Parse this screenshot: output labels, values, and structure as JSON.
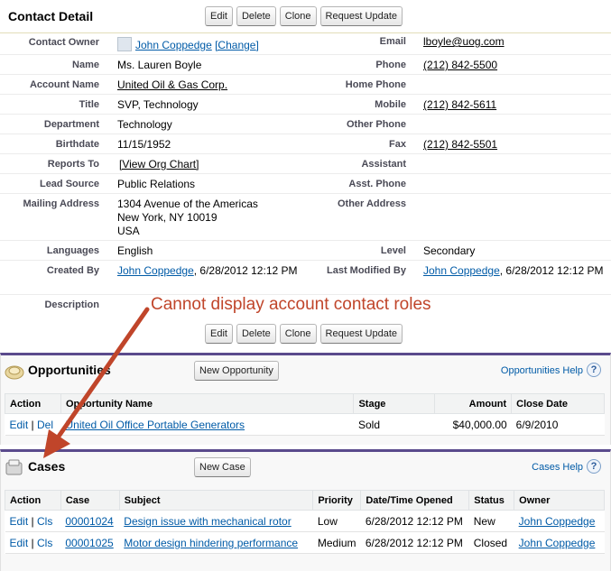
{
  "detail": {
    "title": "Contact Detail",
    "buttons": [
      "Edit",
      "Delete",
      "Clone",
      "Request Update"
    ],
    "contact_owner_label": "Contact Owner",
    "contact_owner": "John Coppedge",
    "change_link": "[Change]",
    "email_label": "Email",
    "email": "lboyle@uog.com",
    "name_label": "Name",
    "name": "Ms. Lauren Boyle",
    "phone_label": "Phone",
    "phone": "(212) 842-5500",
    "account_name_label": "Account Name",
    "account_name": "United Oil & Gas Corp.",
    "home_phone_label": "Home Phone",
    "title_label": "Title",
    "title_value": "SVP, Technology",
    "mobile_label": "Mobile",
    "mobile": "(212) 842-5611",
    "department_label": "Department",
    "department": "Technology",
    "other_phone_label": "Other Phone",
    "birthdate_label": "Birthdate",
    "birthdate": "11/15/1952",
    "fax_label": "Fax",
    "fax": "(212) 842-5501",
    "reports_to_label": "Reports To",
    "view_org_chart": "[View Org Chart]",
    "assistant_label": "Assistant",
    "lead_source_label": "Lead Source",
    "lead_source": "Public Relations",
    "asst_phone_label": "Asst. Phone",
    "mailing_address_label": "Mailing Address",
    "mailing_address_line1": "1304 Avenue of the Americas",
    "mailing_address_line2": "New York, NY 10019",
    "mailing_address_line3": "USA",
    "other_address_label": "Other Address",
    "languages_label": "Languages",
    "languages": "English",
    "level_label": "Level",
    "level": "Secondary",
    "created_by_label": "Created By",
    "created_by_user": "John Coppedge",
    "created_by_date": ", 6/28/2012 12:12 PM",
    "last_modified_label": "Last Modified By",
    "last_modified_user": "John Coppedge",
    "last_modified_date": ", 6/28/2012 12:12 PM",
    "description_label": "Description"
  },
  "annotation": "Cannot display account contact roles",
  "opportunities": {
    "title": "Opportunities",
    "new_button": "New Opportunity",
    "help_link": "Opportunities Help",
    "columns": [
      "Action",
      "Opportunity Name",
      "Stage",
      "Amount",
      "Close Date"
    ],
    "rows": [
      {
        "edit": "Edit",
        "sep": " | ",
        "del": "Del",
        "name": "United Oil Office Portable Generators",
        "stage": "Sold",
        "amount": "$40,000.00",
        "close_date": "6/9/2010"
      }
    ]
  },
  "cases": {
    "title": "Cases",
    "new_button": "New Case",
    "help_link": "Cases Help",
    "columns": [
      "Action",
      "Case",
      "Subject",
      "Priority",
      "Date/Time Opened",
      "Status",
      "Owner"
    ],
    "rows": [
      {
        "edit": "Edit",
        "sep": " | ",
        "cls": "Cls",
        "case": "00001024",
        "subject": "Design issue with mechanical rotor",
        "priority": "Low",
        "opened": "6/28/2012 12:12 PM",
        "status": "New",
        "owner": "John Coppedge"
      },
      {
        "edit": "Edit",
        "sep": " | ",
        "cls": "Cls",
        "case": "00001025",
        "subject": "Motor design hindering performance",
        "priority": "Medium",
        "opened": "6/28/2012 12:12 PM",
        "status": "Closed",
        "owner": "John Coppedge"
      }
    ]
  },
  "help_glyph": "?",
  "colors": {
    "link": "#015ba7",
    "annotation": "#c0452a",
    "list_border": "#5a4a8c"
  }
}
